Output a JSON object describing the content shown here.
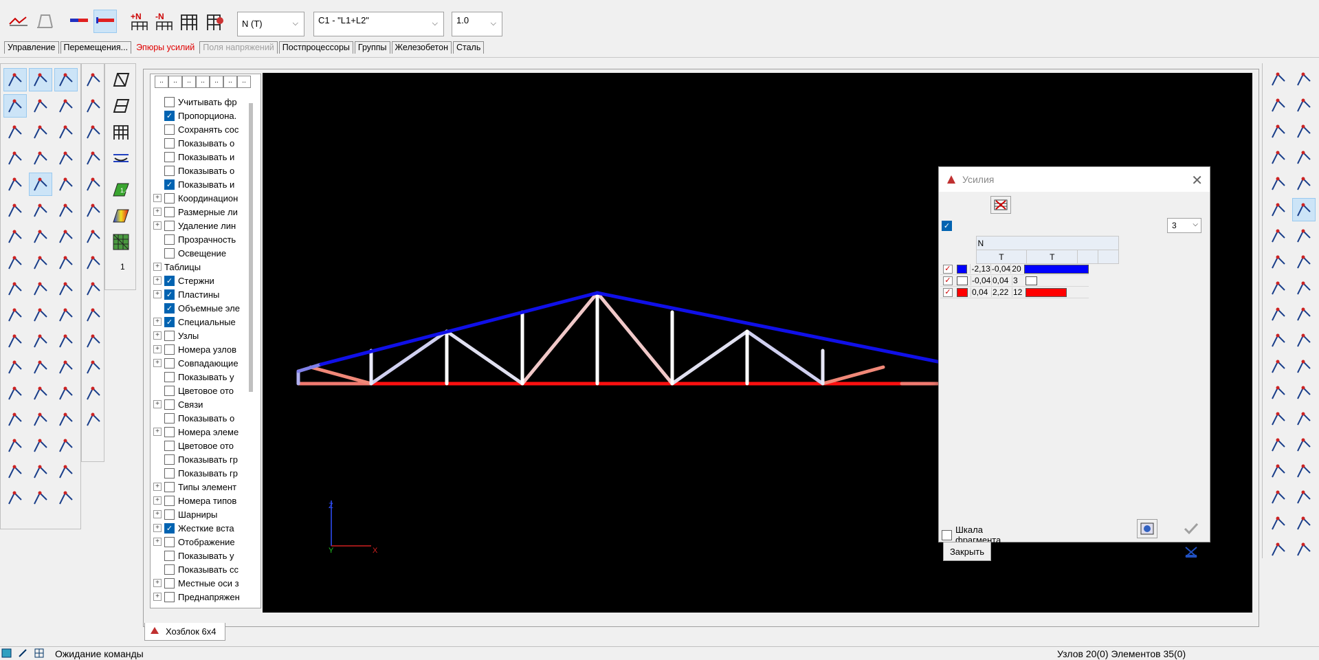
{
  "toolbar": {
    "icons": [
      "load-diagram-icon",
      "deformed-scheme-icon",
      "bar-diagram-icon",
      "diagram-fill-icon",
      "add-N-icon",
      "minus-N-icon",
      "frame-icon",
      "frame-settings-icon"
    ],
    "force_combo": "N (T)",
    "loadcase_combo": "C1 - \"L1+L2\"",
    "scale_combo": "1.0"
  },
  "tabs": [
    {
      "label": "Управление",
      "state": "normal"
    },
    {
      "label": "Перемещения...",
      "state": "normal"
    },
    {
      "label": "Эпюры усилий",
      "state": "active"
    },
    {
      "label": "Поля напряжений",
      "state": "disabled"
    },
    {
      "label": "Постпроцессоры",
      "state": "normal"
    },
    {
      "label": "Группы",
      "state": "normal"
    },
    {
      "label": "Железобетон",
      "state": "normal"
    },
    {
      "label": "Сталь",
      "state": "normal"
    }
  ],
  "palette3": {
    "counter": "1"
  },
  "tree": {
    "tabs": [
      "..",
      "..",
      "..",
      "..",
      "..",
      "..",
      ".."
    ],
    "items": [
      {
        "label": "Учитывать фр",
        "checked": false,
        "expand": false
      },
      {
        "label": "Пропорциона.",
        "checked": true,
        "expand": false
      },
      {
        "label": "Сохранять сос",
        "checked": false,
        "expand": false
      },
      {
        "label": "Показывать о",
        "checked": false,
        "expand": false
      },
      {
        "label": "Показывать и",
        "checked": false,
        "expand": false
      },
      {
        "label": "Показывать о",
        "checked": false,
        "expand": false
      },
      {
        "label": "Показывать и",
        "checked": true,
        "expand": false
      },
      {
        "label": "Координацион",
        "checked": false,
        "expand": true
      },
      {
        "label": "Размерные ли",
        "checked": false,
        "expand": true
      },
      {
        "label": "Удаление лин",
        "checked": false,
        "expand": true
      },
      {
        "label": "Прозрачность",
        "checked": false,
        "expand": false
      },
      {
        "label": "Освещение",
        "checked": false,
        "expand": false
      },
      {
        "label": "Таблицы",
        "checked": null,
        "expand": true
      },
      {
        "label": "Стержни",
        "checked": true,
        "expand": true
      },
      {
        "label": "Пластины",
        "checked": true,
        "expand": true
      },
      {
        "label": "Объемные эле",
        "checked": true,
        "expand": false
      },
      {
        "label": "Специальные",
        "checked": true,
        "expand": true
      },
      {
        "label": "Узлы",
        "checked": false,
        "expand": true
      },
      {
        "label": "Номера узлов",
        "checked": false,
        "expand": true
      },
      {
        "label": "Совпадающие",
        "checked": false,
        "expand": true
      },
      {
        "label": "Показывать у",
        "checked": false,
        "expand": false
      },
      {
        "label": "Цветовое ото",
        "checked": false,
        "expand": false
      },
      {
        "label": "Связи",
        "checked": false,
        "expand": true
      },
      {
        "label": "Показывать о",
        "checked": false,
        "expand": false
      },
      {
        "label": "Номера элеме",
        "checked": false,
        "expand": true
      },
      {
        "label": "Цветовое ото",
        "checked": false,
        "expand": false
      },
      {
        "label": "Показывать гр",
        "checked": false,
        "expand": false
      },
      {
        "label": "Показывать гр",
        "checked": false,
        "expand": false
      },
      {
        "label": "Типы элемент",
        "checked": false,
        "expand": true
      },
      {
        "label": "Номера типов",
        "checked": false,
        "expand": true
      },
      {
        "label": "Шарниры",
        "checked": false,
        "expand": true
      },
      {
        "label": "Жесткие вста",
        "checked": true,
        "expand": true
      },
      {
        "label": "Отображение",
        "checked": false,
        "expand": true
      },
      {
        "label": "Показывать у",
        "checked": false,
        "expand": false
      },
      {
        "label": "Показывать сс",
        "checked": false,
        "expand": false
      },
      {
        "label": "Местные оси з",
        "checked": false,
        "expand": true
      },
      {
        "label": "Преднапряжен",
        "checked": false,
        "expand": true
      }
    ]
  },
  "axes": {
    "z": "Z",
    "y": "Y",
    "x": "X"
  },
  "doc_tab": {
    "title": "Хозблок 6х4"
  },
  "dialog": {
    "title": "Усилия",
    "levels_select": "3",
    "header_force": "N",
    "header_units": [
      "T",
      "T"
    ],
    "rows": [
      {
        "min": "-2,13",
        "max": "-0,04",
        "count": "20",
        "color": "#0000ff",
        "barfrac": 1.0
      },
      {
        "min": "-0,04",
        "max": "0,04",
        "count": "3",
        "color": "#ffffff",
        "barfrac": 0.18
      },
      {
        "min": "0,04",
        "max": "2,22",
        "count": "12",
        "color": "#ff0000",
        "barfrac": 0.62
      }
    ],
    "fragment_scale_label": "Шкала\nфрагмента",
    "close_label": "Закрыть"
  },
  "status": {
    "left_text": "Ожидание команды",
    "right_text": "Узлов 20(0) Элементов 35(0)"
  }
}
